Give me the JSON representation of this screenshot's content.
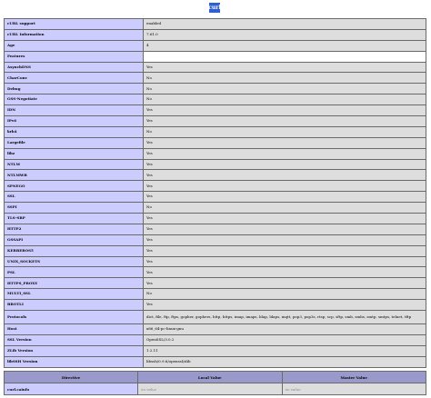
{
  "section": {
    "title": "curl"
  },
  "info_rows": [
    {
      "name": "cURL support",
      "value": "enabled"
    },
    {
      "name": "cURL Information",
      "value": "7.61.0"
    },
    {
      "name": "Age",
      "value": "4"
    },
    {
      "name": "Features",
      "value": ""
    },
    {
      "name": "AsynchDNS",
      "value": "Yes"
    },
    {
      "name": "CharConv",
      "value": "No"
    },
    {
      "name": "Debug",
      "value": "No"
    },
    {
      "name": "GSS-Negotiate",
      "value": "No"
    },
    {
      "name": "IDN",
      "value": "Yes"
    },
    {
      "name": "IPv6",
      "value": "Yes"
    },
    {
      "name": "krb4",
      "value": "No"
    },
    {
      "name": "Largefile",
      "value": "Yes"
    },
    {
      "name": "libz",
      "value": "Yes"
    },
    {
      "name": "NTLM",
      "value": "Yes"
    },
    {
      "name": "NTLMWB",
      "value": "Yes"
    },
    {
      "name": "SPNEGO",
      "value": "Yes"
    },
    {
      "name": "SSL",
      "value": "Yes"
    },
    {
      "name": "SSPI",
      "value": "No"
    },
    {
      "name": "TLS-SRP",
      "value": "Yes"
    },
    {
      "name": "HTTP2",
      "value": "Yes"
    },
    {
      "name": "GSSAPI",
      "value": "Yes"
    },
    {
      "name": "KERBEROS5",
      "value": "Yes"
    },
    {
      "name": "UNIX_SOCKETS",
      "value": "Yes"
    },
    {
      "name": "PSL",
      "value": "Yes"
    },
    {
      "name": "HTTPS_PROXY",
      "value": "Yes"
    },
    {
      "name": "MULTI_SSL",
      "value": "No"
    },
    {
      "name": "BROTLI",
      "value": "Yes"
    },
    {
      "name": "Protocols",
      "value": "dict, file, ftp, ftps, gopher, gophers, http, https, imap, imaps, ldap, ldaps, mqtt, pop3, pop3s, rtsp, scp, sftp, smb, smbs, smtp, smtps, telnet, tftp"
    },
    {
      "name": "Host",
      "value": "x86_64-pc-linux-gnu"
    },
    {
      "name": "SSL Version",
      "value": "OpenSSL/3.0.2"
    },
    {
      "name": "ZLib Version",
      "value": "1.2.11"
    },
    {
      "name": "libSSH Version",
      "value": "libssh/0.9.6/openssl/zlib"
    }
  ],
  "directive_table": {
    "headers": {
      "directive": "Directive",
      "local": "Local Value",
      "master": "Master Value"
    },
    "rows": [
      {
        "name": "curl.cainfo",
        "local": "no value",
        "master": "no value"
      }
    ]
  }
}
